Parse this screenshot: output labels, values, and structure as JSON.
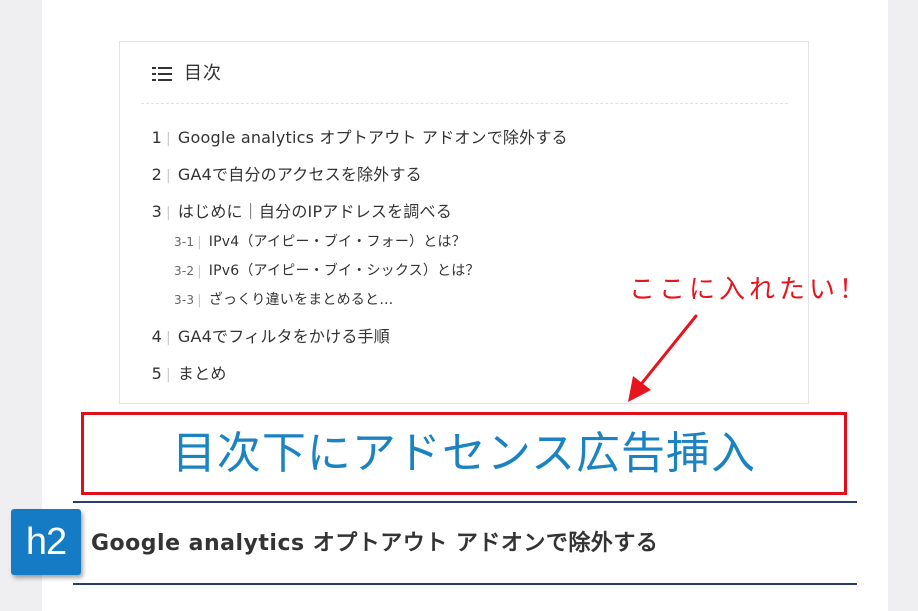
{
  "toc": {
    "title": "目次",
    "separator": "|",
    "items": [
      {
        "num": "1",
        "label": "Google analytics オプトアウト アドオンで除外する"
      },
      {
        "num": "2",
        "label": "GA4で自分のアクセスを除外する"
      },
      {
        "num": "3",
        "label": "はじめに｜自分のIPアドレスを調べる",
        "children": [
          {
            "num": "3-1",
            "label": "IPv4（アイピー・ブイ・フォー）とは？"
          },
          {
            "num": "3-2",
            "label": "IPv6（アイピー・ブイ・シックス）とは？"
          },
          {
            "num": "3-3",
            "label": "ざっくり違いをまとめると…"
          }
        ]
      },
      {
        "num": "4",
        "label": "GA4でフィルタをかける手順"
      },
      {
        "num": "5",
        "label": "まとめ"
      }
    ]
  },
  "annotation": {
    "text": "ここに入れたい！",
    "color": "#e6151d"
  },
  "ad_placeholder": {
    "text": "目次下にアドセンス広告挿入",
    "border_color": "#e10f17",
    "text_color": "#1b83c2"
  },
  "heading": {
    "badge": "h2",
    "title": "Google analytics オプトアウト アドオンで除外する",
    "badge_color": "#157bc4",
    "rule_color": "#2b3c6e"
  }
}
